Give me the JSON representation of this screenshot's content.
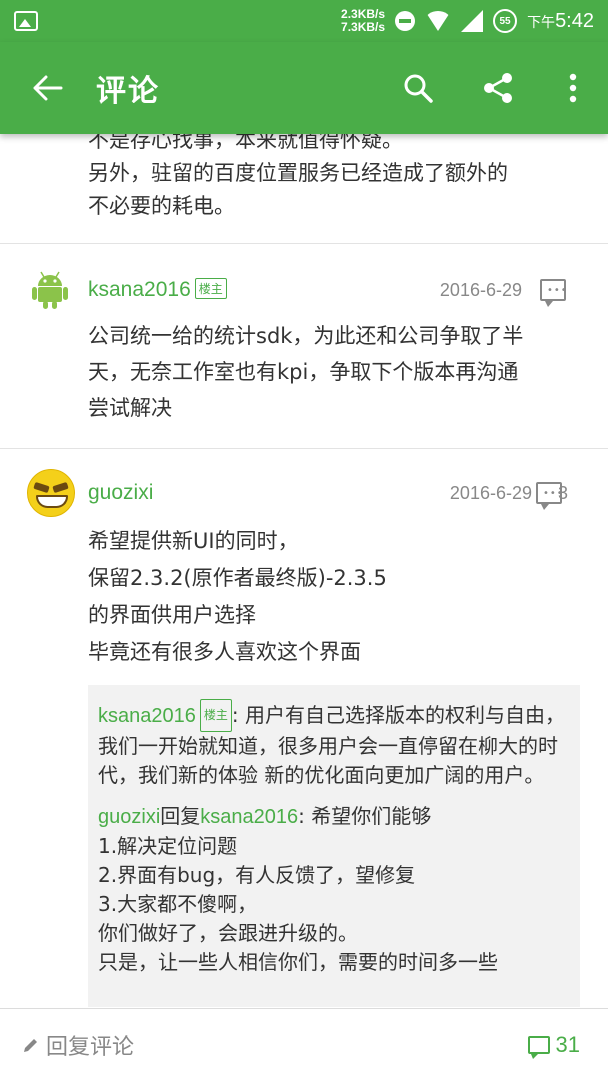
{
  "status_bar": {
    "net_up": "2.3KB/s",
    "net_down": "7.3KB/s",
    "battery": "55",
    "time_prefix": "下午",
    "time": "5:42"
  },
  "app_bar": {
    "title": "评论",
    "icons": [
      "back-arrow-icon",
      "search-icon",
      "share-icon",
      "more-vert-icon"
    ]
  },
  "previous_comment": {
    "lines": [
      "不是存心找事，本来就值得怀疑。",
      "另外，驻留的百度位置服务已经造成了额外的",
      "不必要的耗电。"
    ]
  },
  "comments": [
    {
      "author": "ksana2016",
      "badge": "楼主",
      "date": "2016-6-29",
      "body": [
        "公司统一给的统计sdk，为此还和公司争取了半",
        "天，无奈工作室也有kpi，争取下个版本再沟通",
        "尝试解决"
      ]
    },
    {
      "author": "guozixi",
      "date": "2016-6-29",
      "reply_count": "3",
      "body": [
        "希望提供新UI的同时，",
        "保留2.3.2(原作者最终版)-2.3.5",
        "的界面供用户选择",
        "毕竟还有很多人喜欢这个界面"
      ],
      "replies": [
        {
          "author": "ksana2016",
          "badge": "楼主",
          "text": ": 用户有自己选择版本的权利与自由，我们一开始就知道，很多用户会一直停留在柳大的时代，我们新的体验 新的优化面向更加广阔的用户。"
        },
        {
          "author": "guozixi",
          "reply_word": "回复",
          "target": "ksana2016",
          "text": ": 希望你们能够",
          "lines": [
            "1.解决定位问题",
            "2.界面有bug，有人反馈了，望修复",
            "3.大家都不傻啊，",
            "你们做好了，会跟进升级的。",
            "只是，让一些人相信你们，需要的时间多一些"
          ]
        }
      ]
    }
  ],
  "bottom_bar": {
    "reply_placeholder": "回复评论",
    "comment_total": "31"
  },
  "colors": {
    "primary": "#4aad48",
    "text": "#333333",
    "muted": "#888888"
  }
}
